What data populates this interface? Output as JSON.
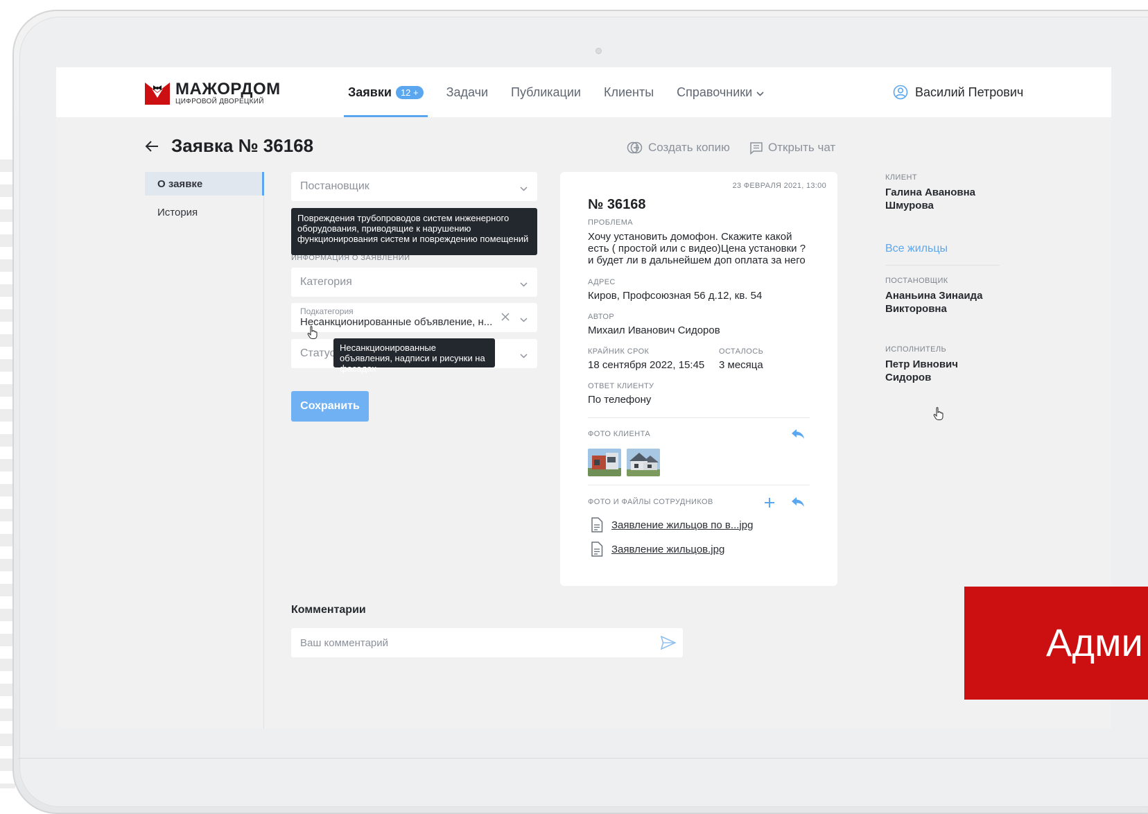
{
  "brand": {
    "title": "МАЖОРДОМ",
    "subtitle": "ЦИФРОВОЙ ДВОРЕЦКИЙ",
    "accent": "#5aa7f0",
    "red": "#cc1011"
  },
  "nav": {
    "items": [
      {
        "label": "Заявки",
        "badge": "12 +"
      },
      {
        "label": "Задачи"
      },
      {
        "label": "Публикации"
      },
      {
        "label": "Клиенты"
      },
      {
        "label": "Справочники"
      }
    ],
    "user": "Василий Петрович"
  },
  "page": {
    "title": "Заявка № 36168",
    "copy_action": "Создать копию",
    "chat_action": "Открыть чат"
  },
  "side": {
    "items": [
      "О заявке",
      "История"
    ]
  },
  "form": {
    "setter_placeholder": "Постановщик",
    "tooltip_problem": "Повреждения трубопроводов систем инженерного оборудования, приводящие к нарушению функционирования систем и повреждению помещений",
    "section_partial": "ИНФОРМАЦИЯ О ЗАЯВЛЕНИИ",
    "category_placeholder": "Категория",
    "subcategory_label": "Подкатегория",
    "subcategory_value": "Несанкционированные объявление, н...",
    "status_placeholder": "Статус",
    "tooltip_subcategory": "Несанкционированные объявления, надписи и рисунки на фасадах",
    "save": "Сохранить"
  },
  "card": {
    "date": "23 ФЕВРАЛЯ 2021, 13:00",
    "number": "№ 36168",
    "problem_label": "ПРОБЛЕМА",
    "problem_lines": [
      "Хочу установить домофон. Скажите какой",
      "есть ( простой или с видео)Цена установки ?",
      "и будет ли в дальнейшем доп оплата за него"
    ],
    "address_label": "АДРЕС",
    "address": "Киров, Профсоюзная 56 д.12, кв. 54",
    "author_label": "АВТОР",
    "author": "Михаил Иванович Сидоров",
    "deadline_label": "КРАЙНИК СРОК",
    "deadline": "18 сентября 2022, 15:45",
    "left_label": "ОСТАЛОСЬ",
    "left": "3 месяца",
    "reply_label": "ОТВЕТ КЛИЕНТУ",
    "reply": "По телефону",
    "client_photos_label": "ФОТО КЛИЕНТА",
    "staff_files_label": "ФОТО И ФАЙЛЫ СОТРУДНИКОВ",
    "files": [
      "Заявление жильцов по в...jpg",
      "Заявление жильцов.jpg"
    ]
  },
  "right": {
    "client_label": "КЛИЕНТ",
    "client": "Галина Авановна Шмурова",
    "all_residents": "Все жильцы",
    "setter_label": "ПОСТАНОВЩИК",
    "setter": "Ананьина Зинаида Викторовна",
    "executor_label": "ИСПОЛНИТЕЛЬ",
    "executor": "Петр Ивнович Сидоров"
  },
  "comments": {
    "title": "Комментарии",
    "placeholder": "Ваш комментарий"
  },
  "banner": {
    "text": "Адми"
  }
}
